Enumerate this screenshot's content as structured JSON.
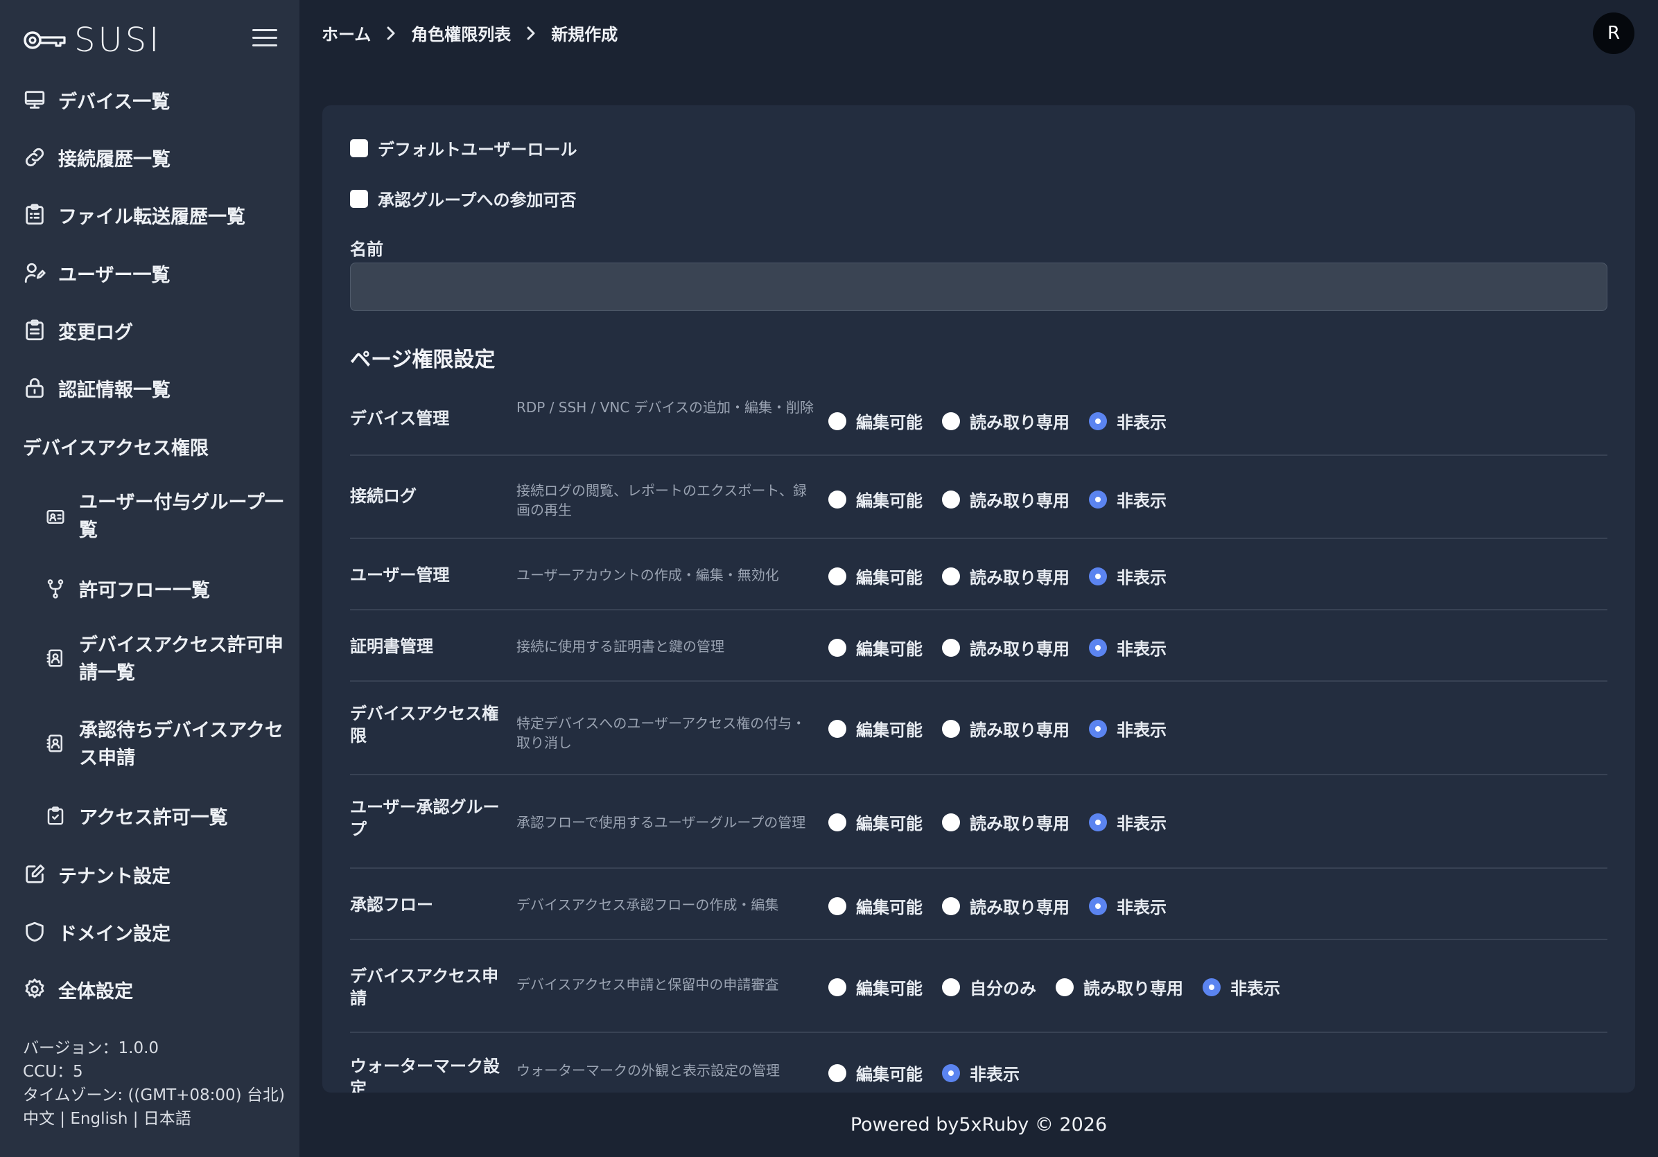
{
  "app": {
    "logo_text": "SUSI"
  },
  "sidebar": {
    "items": [
      {
        "label": "デバイス一覧",
        "icon": "monitor-icon"
      },
      {
        "label": "接続履歴一覧",
        "icon": "link-icon"
      },
      {
        "label": "ファイル転送履歴一覧",
        "icon": "clipboard-list-icon"
      },
      {
        "label": "ユーザー一覧",
        "icon": "user-edit-icon"
      },
      {
        "label": "変更ログ",
        "icon": "clipboard-icon"
      },
      {
        "label": "認証情報一覧",
        "icon": "lock-icon"
      }
    ],
    "section_label": "デバイスアクセス権限",
    "sub_items": [
      {
        "label": "ユーザー付与グループ一覧",
        "icon": "id-card-icon"
      },
      {
        "label": "許可フロー一覧",
        "icon": "git-fork-icon"
      },
      {
        "label": "デバイスアクセス許可申請一覧",
        "icon": "contact-book-icon"
      },
      {
        "label": "承認待ちデバイスアクセス申請",
        "icon": "contact-book-icon"
      },
      {
        "label": "アクセス許可一覧",
        "icon": "clipboard-check-icon"
      }
    ],
    "bottom_items": [
      {
        "label": "テナント設定",
        "icon": "edit-icon"
      },
      {
        "label": "ドメイン設定",
        "icon": "shield-icon"
      },
      {
        "label": "全体設定",
        "icon": "gear-icon"
      }
    ],
    "footer": {
      "version": "バージョン：1.0.0",
      "ccu": "CCU：5",
      "timezone": "タイムゾーン: ((GMT+08:00) 台北)",
      "languages": "中文 | English | 日本語"
    }
  },
  "breadcrumb": [
    "ホーム",
    "角色權限列表",
    "新規作成"
  ],
  "user": {
    "avatar_initial": "R"
  },
  "form": {
    "default_role_label": "デフォルトユーザーロール",
    "approval_group_label": "承認グループへの参加可否",
    "name_label": "名前",
    "name_value": "",
    "section_title": "ページ権限設定"
  },
  "permissions": [
    {
      "name": "デバイス管理",
      "desc": "RDP / SSH / VNC デバイスの追加・編集・削除",
      "options": [
        "編集可能",
        "読み取り専用",
        "非表示"
      ],
      "selected": "非表示"
    },
    {
      "name": "接続ログ",
      "desc": "接続ログの閲覧、レポートのエクスポート、録画の再生",
      "options": [
        "編集可能",
        "読み取り専用",
        "非表示"
      ],
      "selected": "非表示"
    },
    {
      "name": "ユーザー管理",
      "desc": "ユーザーアカウントの作成・編集・無効化",
      "options": [
        "編集可能",
        "読み取り専用",
        "非表示"
      ],
      "selected": "非表示"
    },
    {
      "name": "証明書管理",
      "desc": "接続に使用する証明書と鍵の管理",
      "options": [
        "編集可能",
        "読み取り専用",
        "非表示"
      ],
      "selected": "非表示"
    },
    {
      "name": "デバイスアクセス権限",
      "desc": "特定デバイスへのユーザーアクセス権の付与・取り消し",
      "options": [
        "編集可能",
        "読み取り専用",
        "非表示"
      ],
      "selected": "非表示"
    },
    {
      "name": "ユーザー承認グループ",
      "desc": "承認フローで使用するユーザーグループの管理",
      "options": [
        "編集可能",
        "読み取り専用",
        "非表示"
      ],
      "selected": "非表示"
    },
    {
      "name": "承認フロー",
      "desc": "デバイスアクセス承認フローの作成・編集",
      "options": [
        "編集可能",
        "読み取り専用",
        "非表示"
      ],
      "selected": "非表示"
    },
    {
      "name": "デバイスアクセス申請",
      "desc": "デバイスアクセス申請と保留中の申請審査",
      "options": [
        "編集可能",
        "自分のみ",
        "読み取り専用",
        "非表示"
      ],
      "selected": "非表示"
    },
    {
      "name": "ウォーターマーク設定",
      "desc": "ウォーターマークの外観と表示設定の管理",
      "options": [
        "編集可能",
        "非表示"
      ],
      "selected": "非表示"
    }
  ],
  "footer": {
    "text": "Powered by5xRuby © 2026"
  },
  "colors": {
    "sidebar_bg": "#283141",
    "main_bg": "#1b2332",
    "card_bg": "#232d3f",
    "radio_accent": "#5b84f0"
  }
}
